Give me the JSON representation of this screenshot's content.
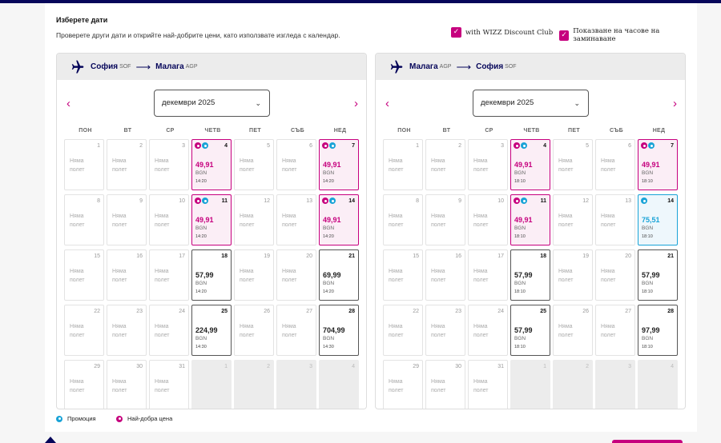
{
  "header": {
    "title": "Изберете дати",
    "subtitle": "Проверете други дати и открийте най-добрите цени, като използвате изгледа с календар.",
    "checkbox_discount": "with WIZZ Discount Club",
    "checkbox_times": "Показване на часове на заминаване"
  },
  "weekdays": [
    "ПОН",
    "ВТ",
    "СР",
    "ЧЕТВ",
    "ПЕТ",
    "СЪБ",
    "НЕД"
  ],
  "legend": {
    "promo": "Промоция",
    "best": "Най-добра цена"
  },
  "colors": {
    "brand": "#c6007e",
    "navy": "#06065a",
    "promo": "#19a3d7"
  },
  "outbound": {
    "from_city": "София",
    "from_code": "SOF",
    "to_city": "Малага",
    "to_code": "AGP",
    "month": "декември 2025",
    "days": [
      {
        "d": "1",
        "t": "nf"
      },
      {
        "d": "2",
        "t": "nf"
      },
      {
        "d": "3",
        "t": "nf"
      },
      {
        "d": "4",
        "t": "best",
        "price": "49,91",
        "time": "14:20",
        "badges": [
          "b",
          "p"
        ]
      },
      {
        "d": "5",
        "t": "nf"
      },
      {
        "d": "6",
        "t": "nf"
      },
      {
        "d": "7",
        "t": "best",
        "price": "49,91",
        "time": "14:20",
        "badges": [
          "b",
          "p"
        ]
      },
      {
        "d": "8",
        "t": "nf"
      },
      {
        "d": "9",
        "t": "nf"
      },
      {
        "d": "10",
        "t": "nf"
      },
      {
        "d": "11",
        "t": "best",
        "price": "49,91",
        "time": "14:20",
        "badges": [
          "b",
          "p"
        ]
      },
      {
        "d": "12",
        "t": "nf"
      },
      {
        "d": "13",
        "t": "nf"
      },
      {
        "d": "14",
        "t": "best",
        "price": "49,91",
        "time": "14:20",
        "badges": [
          "b",
          "p"
        ]
      },
      {
        "d": "15",
        "t": "nf"
      },
      {
        "d": "16",
        "t": "nf"
      },
      {
        "d": "17",
        "t": "nf"
      },
      {
        "d": "18",
        "t": "priced",
        "price": "57,99",
        "time": "14:20"
      },
      {
        "d": "19",
        "t": "nf"
      },
      {
        "d": "20",
        "t": "nf"
      },
      {
        "d": "21",
        "t": "priced",
        "price": "69,99",
        "time": "14:20"
      },
      {
        "d": "22",
        "t": "nf"
      },
      {
        "d": "23",
        "t": "nf"
      },
      {
        "d": "24",
        "t": "nf"
      },
      {
        "d": "25",
        "t": "priced",
        "price": "224,99",
        "time": "14:30"
      },
      {
        "d": "26",
        "t": "nf"
      },
      {
        "d": "27",
        "t": "nf"
      },
      {
        "d": "28",
        "t": "priced",
        "price": "704,99",
        "time": "14:30"
      },
      {
        "d": "29",
        "t": "nf"
      },
      {
        "d": "30",
        "t": "nf"
      },
      {
        "d": "31",
        "t": "nf"
      },
      {
        "d": "1",
        "t": "empty"
      },
      {
        "d": "2",
        "t": "empty"
      },
      {
        "d": "3",
        "t": "empty"
      },
      {
        "d": "4",
        "t": "empty"
      }
    ]
  },
  "return": {
    "from_city": "Малага",
    "from_code": "AGP",
    "to_city": "София",
    "to_code": "SOF",
    "month": "декември 2025",
    "days": [
      {
        "d": "1",
        "t": "nf"
      },
      {
        "d": "2",
        "t": "nf"
      },
      {
        "d": "3",
        "t": "nf"
      },
      {
        "d": "4",
        "t": "best",
        "price": "49,91",
        "time": "18:10",
        "badges": [
          "b",
          "p"
        ]
      },
      {
        "d": "5",
        "t": "nf"
      },
      {
        "d": "6",
        "t": "nf"
      },
      {
        "d": "7",
        "t": "best",
        "price": "49,91",
        "time": "18:10",
        "badges": [
          "b",
          "p"
        ]
      },
      {
        "d": "8",
        "t": "nf"
      },
      {
        "d": "9",
        "t": "nf"
      },
      {
        "d": "10",
        "t": "nf"
      },
      {
        "d": "11",
        "t": "best",
        "price": "49,91",
        "time": "18:10",
        "badges": [
          "b",
          "p"
        ]
      },
      {
        "d": "12",
        "t": "nf"
      },
      {
        "d": "13",
        "t": "nf"
      },
      {
        "d": "14",
        "t": "promo",
        "price": "75,51",
        "time": "18:10",
        "badges": [
          "p"
        ]
      },
      {
        "d": "15",
        "t": "nf"
      },
      {
        "d": "16",
        "t": "nf"
      },
      {
        "d": "17",
        "t": "nf"
      },
      {
        "d": "18",
        "t": "priced",
        "price": "57,99",
        "time": "18:10"
      },
      {
        "d": "19",
        "t": "nf"
      },
      {
        "d": "20",
        "t": "nf"
      },
      {
        "d": "21",
        "t": "priced",
        "price": "57,99",
        "time": "18:10"
      },
      {
        "d": "22",
        "t": "nf"
      },
      {
        "d": "23",
        "t": "nf"
      },
      {
        "d": "24",
        "t": "nf"
      },
      {
        "d": "25",
        "t": "priced",
        "price": "57,99",
        "time": "18:10"
      },
      {
        "d": "26",
        "t": "nf"
      },
      {
        "d": "27",
        "t": "nf"
      },
      {
        "d": "28",
        "t": "priced",
        "price": "97,99",
        "time": "18:10"
      },
      {
        "d": "29",
        "t": "nf"
      },
      {
        "d": "30",
        "t": "nf"
      },
      {
        "d": "31",
        "t": "nf"
      },
      {
        "d": "1",
        "t": "empty"
      },
      {
        "d": "2",
        "t": "empty"
      },
      {
        "d": "3",
        "t": "empty"
      },
      {
        "d": "4",
        "t": "empty"
      }
    ]
  },
  "cell_text": {
    "no_flight_1": "Няма",
    "no_flight_2": "полет",
    "currency": "BGN"
  }
}
